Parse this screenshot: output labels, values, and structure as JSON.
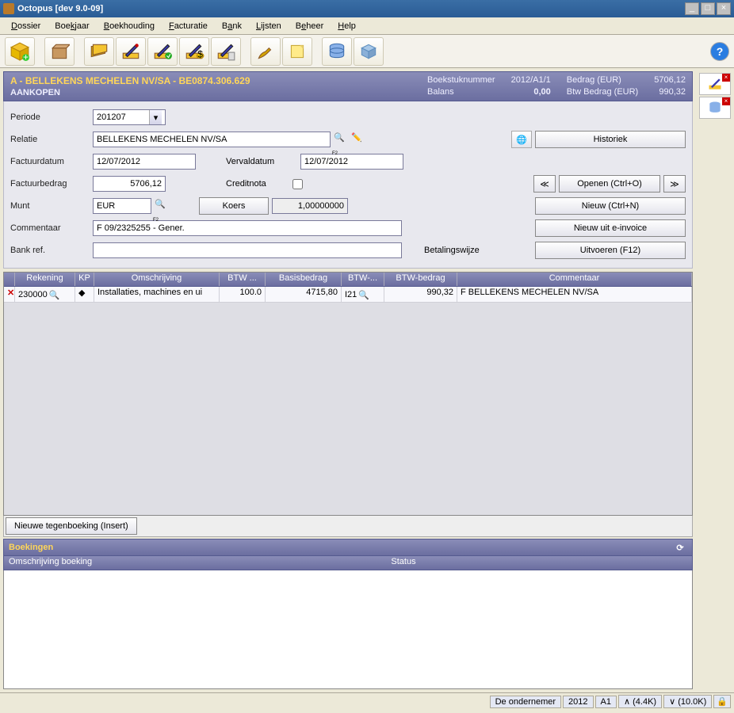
{
  "window": {
    "title": "Octopus [dev 9.0-09]"
  },
  "menu": [
    "Dossier",
    "Boekjaar",
    "Boekhouding",
    "Facturatie",
    "Bank",
    "Lijsten",
    "Beheer",
    "Help"
  ],
  "header": {
    "company_line": "A - BELLEKENS MECHELEN NV/SA - BE0874.306.629",
    "subtitle": "AANKOPEN",
    "boekstuk_label": "Boekstuknummer",
    "boekstuk_value": "2012/A1/1",
    "balans_label": "Balans",
    "balans_value": "0,00",
    "bedrag_label": "Bedrag (EUR)",
    "bedrag_value": "5706,12",
    "btw_label": "Btw Bedrag (EUR)",
    "btw_value": "990,32"
  },
  "form": {
    "periode_label": "Periode",
    "periode_value": "201207",
    "relatie_label": "Relatie",
    "relatie_value": "BELLEKENS MECHELEN NV/SA",
    "historiek": "Historiek",
    "factuurdatum_label": "Factuurdatum",
    "factuurdatum_value": "12/07/2012",
    "vervaldatum_label": "Vervaldatum",
    "vervaldatum_value": "12/07/2012",
    "factuurbedrag_label": "Factuurbedrag",
    "factuurbedrag_value": "5706,12",
    "creditnota_label": "Creditnota",
    "munt_label": "Munt",
    "munt_value": "EUR",
    "koers_btn": "Koers",
    "koers_value": "1,00000000",
    "commentaar_label": "Commentaar",
    "commentaar_value": "F 09/2325255 - Gener.",
    "bankref_label": "Bank ref.",
    "bankref_value": "",
    "betalingswijze_label": "Betalingswijze",
    "openen": "Openen (Ctrl+O)",
    "nieuw": "Nieuw (Ctrl+N)",
    "nieuw_einvoice": "Nieuw uit e-invoice",
    "uitvoeren": "Uitvoeren (F12)"
  },
  "grid": {
    "headers": {
      "rekening": "Rekening",
      "kp": "KP",
      "omschrijving": "Omschrijving",
      "btw": "BTW ...",
      "basis": "Basisbedrag",
      "btwc": "BTW-...",
      "btwb": "BTW-bedrag",
      "com": "Commentaar"
    },
    "rows": [
      {
        "rekening": "230000",
        "kp": "",
        "omschrijving": "Installaties, machines en ui",
        "btw": "100.0",
        "basis": "4715,80",
        "btwc": "I21",
        "btwb": "990,32",
        "com": "F  BELLEKENS MECHELEN NV/SA"
      }
    ],
    "new_btn": "Nieuwe tegenboeking (Insert)"
  },
  "boekingen": {
    "title": "Boekingen",
    "col1": "Omschrijving boeking",
    "col2": "Status"
  },
  "status": {
    "company": "De ondernemer",
    "year": "2012",
    "journal": "A1",
    "up": "(4.4K)",
    "down": "(10.0K)"
  }
}
